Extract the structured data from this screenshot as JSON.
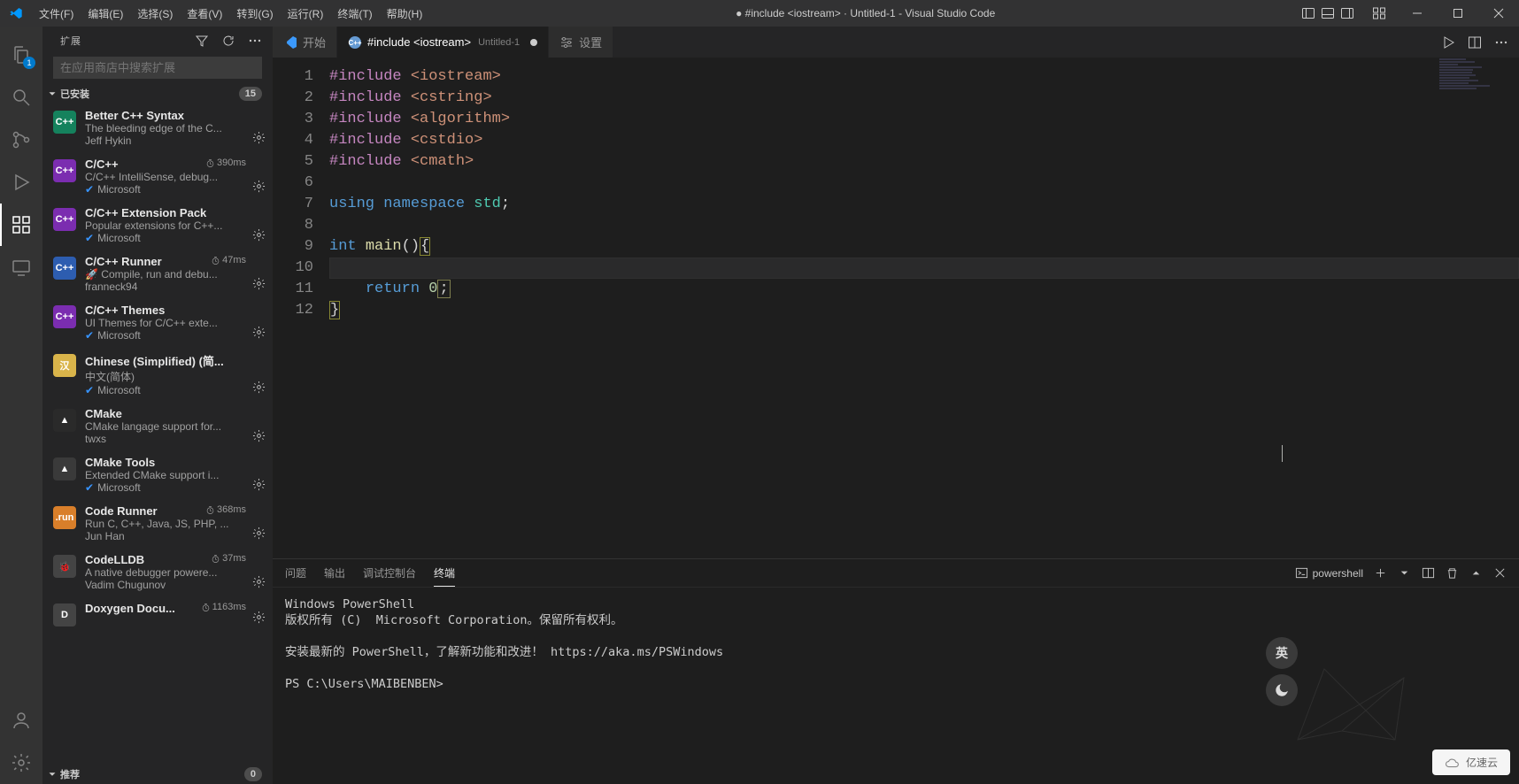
{
  "titlebar": {
    "menus": [
      "文件(F)",
      "编辑(E)",
      "选择(S)",
      "查看(V)",
      "转到(G)",
      "运行(R)",
      "终端(T)",
      "帮助(H)"
    ],
    "title": "● #include <iostream> · Untitled-1 - Visual Studio Code"
  },
  "activitybar": {
    "explorer_badge": "1"
  },
  "sidebar": {
    "title": "扩展",
    "search_placeholder": "在应用商店中搜索扩展",
    "installed": {
      "label": "已安装",
      "count": "15"
    },
    "recommended": {
      "label": "推荐",
      "count": "0"
    },
    "extensions": [
      {
        "name": "Better C++ Syntax",
        "desc": "The bleeding edge of the C...",
        "publisher": "Jeff Hykin",
        "verified": false,
        "timing": "",
        "icon_bg": "#15825d",
        "icon_text": "C++"
      },
      {
        "name": "C/C++",
        "desc": "C/C++ IntelliSense, debug...",
        "publisher": "Microsoft",
        "verified": true,
        "timing": "390ms",
        "icon_bg": "#7b2db0",
        "icon_text": "C++"
      },
      {
        "name": "C/C++ Extension Pack",
        "desc": "Popular extensions for C++...",
        "publisher": "Microsoft",
        "verified": true,
        "timing": "",
        "icon_bg": "#7b2db0",
        "icon_text": "C++"
      },
      {
        "name": "C/C++ Runner",
        "desc": "🚀 Compile, run and debu...",
        "publisher": "franneck94",
        "verified": false,
        "timing": "47ms",
        "icon_bg": "#2d5db0",
        "icon_text": "C++"
      },
      {
        "name": "C/C++ Themes",
        "desc": "UI Themes for C/C++ exte...",
        "publisher": "Microsoft",
        "verified": true,
        "timing": "",
        "icon_bg": "#7b2db0",
        "icon_text": "C++"
      },
      {
        "name": "Chinese (Simplified) (简...",
        "desc": "中文(简体)",
        "publisher": "Microsoft",
        "verified": true,
        "timing": "",
        "icon_bg": "#d9b44a",
        "icon_text": "汉"
      },
      {
        "name": "CMake",
        "desc": "CMake langage support for...",
        "publisher": "twxs",
        "verified": false,
        "timing": "",
        "icon_bg": "#2a2a2a",
        "icon_text": "▲"
      },
      {
        "name": "CMake Tools",
        "desc": "Extended CMake support i...",
        "publisher": "Microsoft",
        "verified": true,
        "timing": "",
        "icon_bg": "#3a3a3a",
        "icon_text": "▲"
      },
      {
        "name": "Code Runner",
        "desc": "Run C, C++, Java, JS, PHP, ...",
        "publisher": "Jun Han",
        "verified": false,
        "timing": "368ms",
        "icon_bg": "#d97f2a",
        "icon_text": ".run"
      },
      {
        "name": "CodeLLDB",
        "desc": "A native debugger powere...",
        "publisher": "Vadim Chugunov",
        "verified": false,
        "timing": "37ms",
        "icon_bg": "#444",
        "icon_text": "🐞"
      },
      {
        "name": "Doxygen Docu...",
        "desc": "",
        "publisher": "",
        "verified": false,
        "timing": "1163ms",
        "icon_bg": "#444",
        "icon_text": "D"
      }
    ]
  },
  "tabs": {
    "welcome": "开始",
    "active_name": "#include <iostream>",
    "active_sub": "Untitled-1",
    "settings": "设置"
  },
  "editor_actions": {
    "run": "run",
    "split": "split",
    "more": "more"
  },
  "code": {
    "lines": [
      {
        "n": "1",
        "tokens": [
          [
            "#include ",
            "dir"
          ],
          [
            "<iostream>",
            "inc"
          ]
        ]
      },
      {
        "n": "2",
        "tokens": [
          [
            "#include ",
            "dir"
          ],
          [
            "<cstring>",
            "inc"
          ]
        ]
      },
      {
        "n": "3",
        "tokens": [
          [
            "#include ",
            "dir"
          ],
          [
            "<algorithm>",
            "inc"
          ]
        ]
      },
      {
        "n": "4",
        "tokens": [
          [
            "#include ",
            "dir"
          ],
          [
            "<cstdio>",
            "inc"
          ]
        ]
      },
      {
        "n": "5",
        "tokens": [
          [
            "#include ",
            "dir"
          ],
          [
            "<cmath>",
            "inc"
          ]
        ]
      },
      {
        "n": "6",
        "tokens": []
      },
      {
        "n": "7",
        "tokens": [
          [
            "using ",
            "kw"
          ],
          [
            "namespace ",
            "kw"
          ],
          [
            "std",
            "ns"
          ],
          [
            ";",
            "punc"
          ]
        ]
      },
      {
        "n": "8",
        "tokens": []
      },
      {
        "n": "9",
        "tokens": [
          [
            "int ",
            "type"
          ],
          [
            "main",
            "func"
          ],
          [
            "()",
            "punc"
          ],
          [
            "{",
            "punc-hl"
          ]
        ]
      },
      {
        "n": "10",
        "tokens": [],
        "current": true
      },
      {
        "n": "11",
        "tokens": [
          [
            "    ",
            "punc"
          ],
          [
            "return ",
            "kw"
          ],
          [
            "0",
            "num"
          ],
          [
            ";",
            "punc-box"
          ]
        ]
      },
      {
        "n": "12",
        "tokens": [
          [
            "}",
            "punc-hl"
          ]
        ]
      }
    ]
  },
  "panel": {
    "tabs": {
      "problems": "问题",
      "output": "输出",
      "debug": "调试控制台",
      "terminal": "终端"
    },
    "shell_name": "powershell",
    "content": "Windows PowerShell\n版权所有 (C)  Microsoft Corporation。保留所有权利。\n\n安装最新的 PowerShell，了解新功能和改进！ https://aka.ms/PSWindows\n\nPS C:\\Users\\MAIBENBEN>"
  },
  "float": {
    "lang": "英",
    "cloud_text": "亿速云"
  }
}
